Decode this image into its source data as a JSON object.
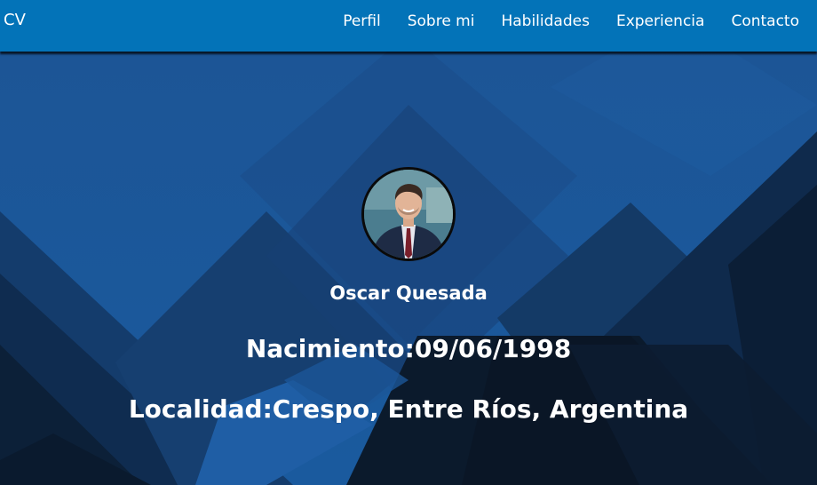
{
  "nav": {
    "brand": "CV",
    "links": [
      {
        "label": "Perfil"
      },
      {
        "label": "Sobre mi"
      },
      {
        "label": "Habilidades"
      },
      {
        "label": "Experiencia"
      },
      {
        "label": "Contacto"
      }
    ]
  },
  "profile": {
    "name": "Oscar Quesada",
    "birth_label": "Nacimiento:",
    "birth_value": "09/06/1998",
    "location_label": "Localidad:",
    "location_value": "Crespo, Entre Ríos, Argentina"
  },
  "colors": {
    "navbar": "#0373b8",
    "hero_blue": "#1c5a9c",
    "hero_dark": "#0b1b2e",
    "text": "#ffffff"
  }
}
